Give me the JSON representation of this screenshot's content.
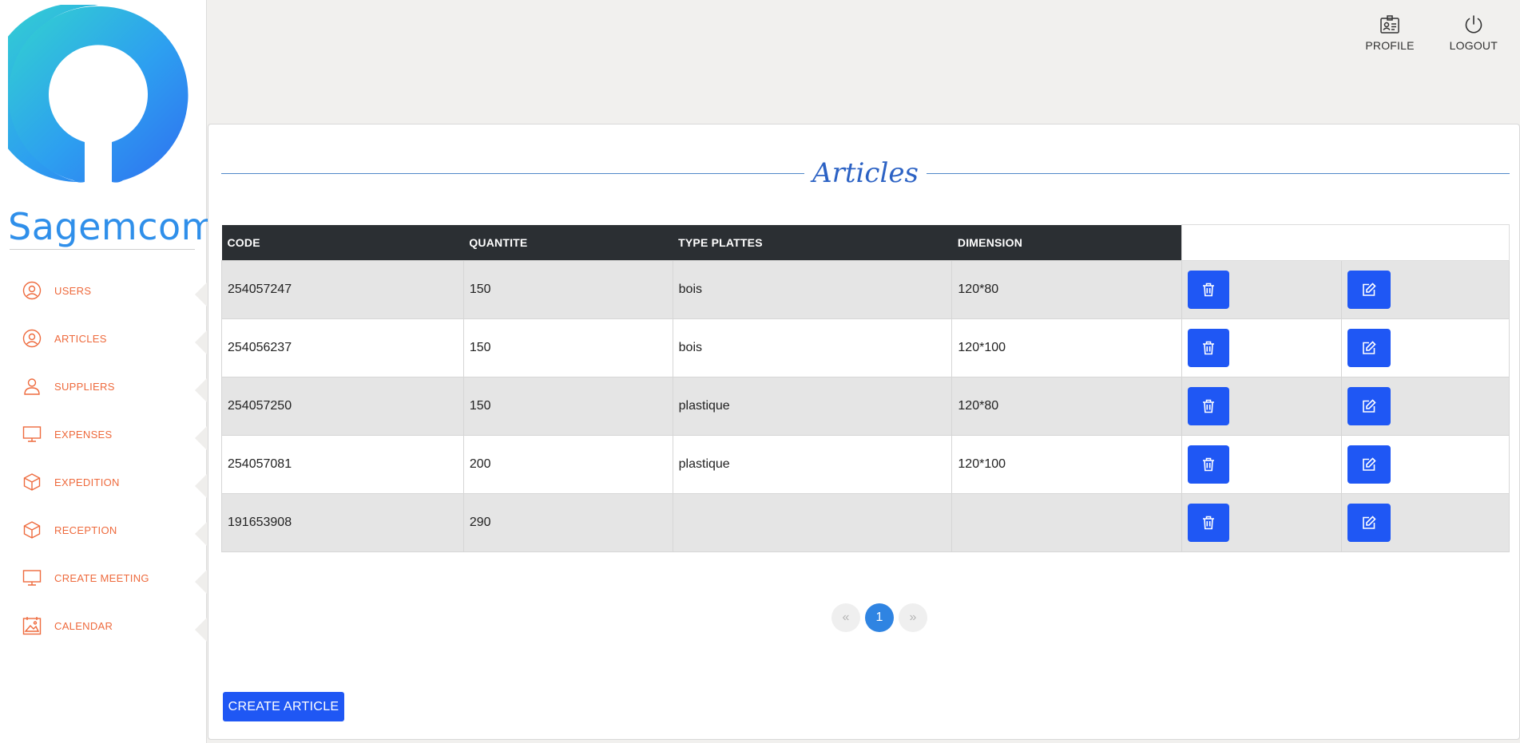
{
  "brand": {
    "name": "Sagemcom"
  },
  "sidebar": {
    "items": [
      {
        "label": "USERS",
        "icon": "user-circle-icon"
      },
      {
        "label": "ARTICLES",
        "icon": "user-circle-icon"
      },
      {
        "label": "SUPPLIERS",
        "icon": "user-icon"
      },
      {
        "label": "EXPENSES",
        "icon": "monitor-icon"
      },
      {
        "label": "EXPEDITION",
        "icon": "box-icon"
      },
      {
        "label": "RECEPTION",
        "icon": "box-icon"
      },
      {
        "label": "CREATE MEETING",
        "icon": "monitor-icon"
      },
      {
        "label": "CALENDAR",
        "icon": "calendar-image-icon"
      }
    ]
  },
  "topbar": {
    "profile_label": "PROFILE",
    "logout_label": "LOGOUT"
  },
  "page": {
    "title": "Articles"
  },
  "table": {
    "headers": [
      "CODE",
      "QUANTITE",
      "TYPE PLATTES",
      "DIMENSION"
    ],
    "rows": [
      {
        "code": "254057247",
        "quantite": "150",
        "type": "bois",
        "dimension": "120*80"
      },
      {
        "code": "254056237",
        "quantite": "150",
        "type": "bois",
        "dimension": "120*100"
      },
      {
        "code": "254057250",
        "quantite": "150",
        "type": "plastique",
        "dimension": "120*80"
      },
      {
        "code": "254057081",
        "quantite": "200",
        "type": "plastique",
        "dimension": "120*100"
      },
      {
        "code": "191653908",
        "quantite": "290",
        "type": "",
        "dimension": ""
      }
    ]
  },
  "pagination": {
    "prev": "«",
    "current": "1",
    "next": "»"
  },
  "actions": {
    "create_label": "CREATE ARTICLE"
  },
  "colors": {
    "accent": "#1f57f4",
    "nav_text": "#ee6a3d",
    "header_bg": "#2b2f33",
    "title": "#2c62c4"
  }
}
